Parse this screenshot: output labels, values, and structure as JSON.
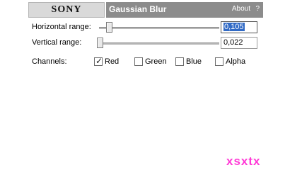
{
  "header": {
    "brand": "SONY",
    "title": "Gaussian Blur",
    "about_label": "About",
    "help_label": "?"
  },
  "sliders": {
    "horizontal": {
      "label": "Horizontal range:",
      "value": "0,105",
      "level": 0.105
    },
    "vertical": {
      "label": "Vertical range:",
      "value": "0,022",
      "level": 0.022
    }
  },
  "channels": {
    "label": "Channels:",
    "items": [
      {
        "label": "Red",
        "checked": true
      },
      {
        "label": "Green",
        "checked": false
      },
      {
        "label": "Blue",
        "checked": false
      },
      {
        "label": "Alpha",
        "checked": false
      }
    ]
  },
  "watermark": "xsxtx",
  "colors": {
    "titlebar": "#8c8c8c",
    "selection": "#316ac5",
    "watermark": "#ff3ad6"
  }
}
